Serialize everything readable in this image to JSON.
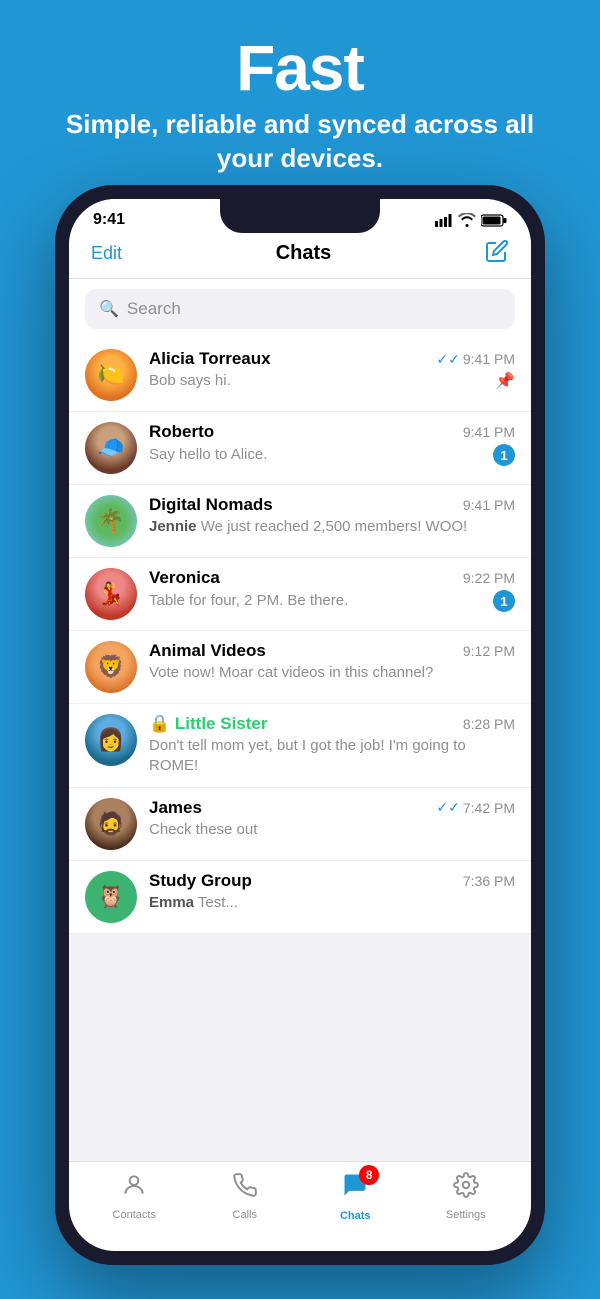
{
  "hero": {
    "title": "Fast",
    "subtitle": "Simple, reliable and synced across all your devices."
  },
  "status_bar": {
    "time": "9:41",
    "signal": "signal-icon",
    "wifi": "wifi-icon",
    "battery": "battery-icon"
  },
  "nav": {
    "edit_label": "Edit",
    "title": "Chats",
    "compose_icon": "compose-icon"
  },
  "search": {
    "placeholder": "Search"
  },
  "chats": [
    {
      "id": "alicia",
      "name": "Alicia Torreaux",
      "preview": "Bob says hi.",
      "time": "9:41 PM",
      "double_check": true,
      "pin": true,
      "badge": 0
    },
    {
      "id": "roberto",
      "name": "Roberto",
      "preview": "Say hello to Alice.",
      "time": "9:41 PM",
      "double_check": false,
      "pin": false,
      "badge": 1
    },
    {
      "id": "nomads",
      "name": "Digital Nomads",
      "preview_sender": "Jennie",
      "preview": "We just reached 2,500 members! WOO!",
      "time": "9:41 PM",
      "double_check": false,
      "pin": false,
      "badge": 0
    },
    {
      "id": "veronica",
      "name": "Veronica",
      "preview": "Table for four, 2 PM. Be there.",
      "time": "9:22 PM",
      "double_check": false,
      "pin": false,
      "badge": 1
    },
    {
      "id": "animals",
      "name": "Animal Videos",
      "preview": "Vote now! Moar cat videos in this channel?",
      "time": "9:12 PM",
      "double_check": false,
      "pin": false,
      "badge": 0
    },
    {
      "id": "sister",
      "name": "Little Sister",
      "preview": "Don't tell mom yet, but I got the job! I'm going to ROME!",
      "time": "8:28 PM",
      "double_check": false,
      "pin": false,
      "badge": 0,
      "locked": true
    },
    {
      "id": "james",
      "name": "James",
      "preview": "Check these out",
      "time": "7:42 PM",
      "double_check": true,
      "pin": false,
      "badge": 0
    },
    {
      "id": "study",
      "name": "Study Group",
      "preview_sender": "Emma",
      "preview": "Test...",
      "time": "7:36 PM",
      "double_check": false,
      "pin": false,
      "badge": 0
    }
  ],
  "tabs": [
    {
      "id": "contacts",
      "label": "Contacts",
      "icon": "person-icon",
      "active": false,
      "badge": 0
    },
    {
      "id": "calls",
      "label": "Calls",
      "icon": "phone-icon",
      "active": false,
      "badge": 0
    },
    {
      "id": "chats",
      "label": "Chats",
      "icon": "chat-icon",
      "active": true,
      "badge": 8
    },
    {
      "id": "settings",
      "label": "Settings",
      "icon": "settings-icon",
      "active": false,
      "badge": 0
    }
  ]
}
